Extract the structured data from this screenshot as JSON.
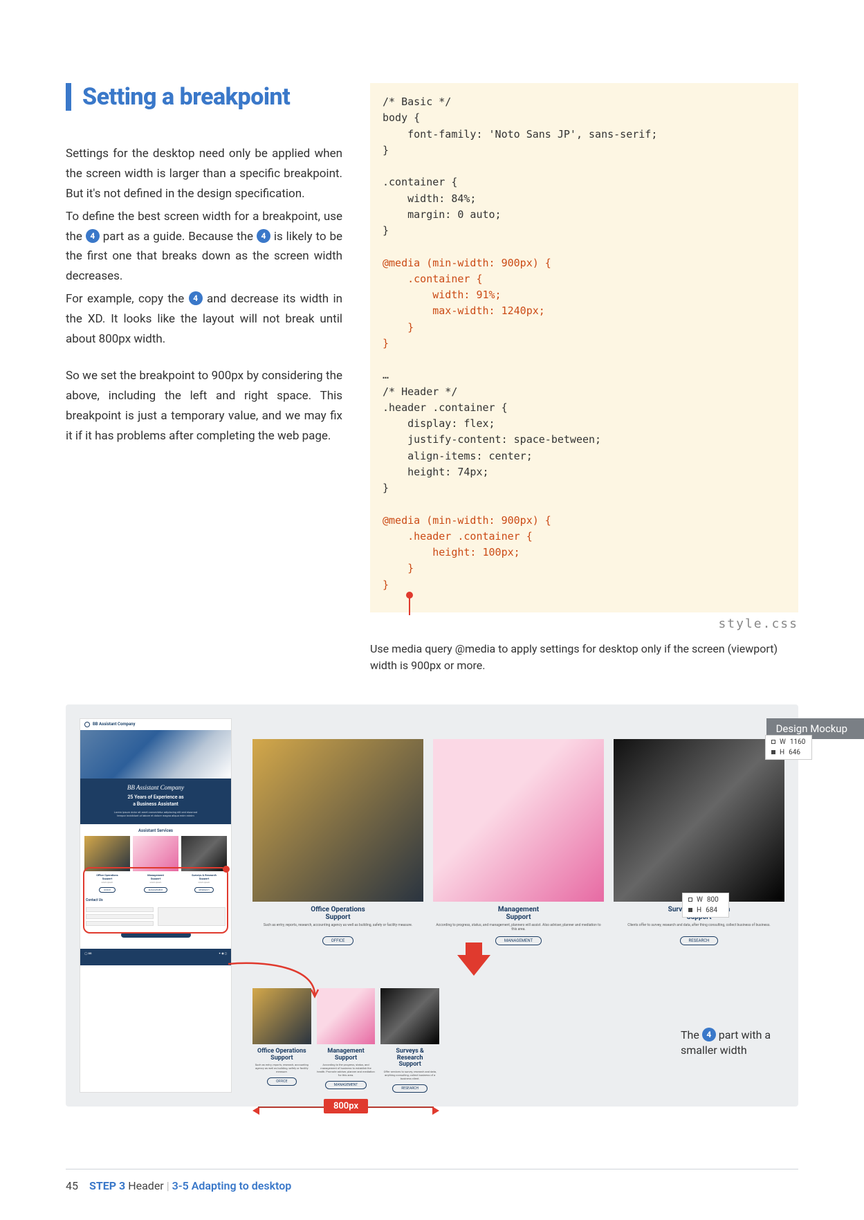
{
  "title": "Setting a breakpoint",
  "para1a": "Settings for the desktop need only be applied when the screen width is larger than a specific breakpoint. But it's not defined in the design specification.",
  "para1b_pre": "To define the best screen width for a breakpoint, use the ",
  "para1b_mid": " part as a guide. Because the ",
  "para1b_post": " is likely to be the first one that breaks down as the screen width decreases.",
  "para1c_pre": "For example, copy the ",
  "para1c_post": " and decrease its width in the XD. It looks like the layout will not break until about 800px width.",
  "para2": "So we set the breakpoint to 900px by considering the above, including the left and right space. This breakpoint is just a temporary value, and we may fix it if it has problems after completing the web page.",
  "badge_num": "4",
  "code": {
    "l1": "/* Basic */",
    "l2": "body {",
    "l3": "    font-family: 'Noto Sans JP', sans-serif;",
    "l4": "}",
    "s": "",
    "l5": ".container {",
    "l6": "    width: 84%;",
    "l7": "    margin: 0 auto;",
    "l8": "}",
    "m1a": "@media (min-width: 900px) {",
    "m1b": "    .container {",
    "m1c": "        width: 91%;",
    "m1d": "        max-width: 1240px;",
    "m1e": "    }",
    "m1f": "}",
    "dots": "…",
    "h1": "/* Header */",
    "h2": ".header .container {",
    "h3": "    display: flex;",
    "h4": "    justify-content: space-between;",
    "h5": "    align-items: center;",
    "h6": "    height: 74px;",
    "h7": "}",
    "m2a": "@media (min-width: 900px) {",
    "m2b": "    .header .container {",
    "m2c": "        height: 100px;",
    "m2d": "    }",
    "m2e": "}"
  },
  "filename": "style.css",
  "caption": "Use media query @media to apply settings for desktop only if the screen (viewport) width is 900px or more.",
  "mockup_tag": "Design Mockup",
  "mock": {
    "company": "BB Assistant Company",
    "tagline": "25 Years of Experience as\na Business Assistant",
    "services_label": "Assistant Services",
    "contact": "Contact Us",
    "cards": [
      {
        "title": "Office Operations\nSupport",
        "btn": "OFFICE"
      },
      {
        "title": "Management\nSupport",
        "btn": "MANAGEMENT"
      },
      {
        "title": "Surveys & Research\nSupport",
        "btn": "RESEARCH"
      }
    ],
    "narrow_cards": [
      {
        "title": "Office Operations\nSupport",
        "btn": "OFFICE"
      },
      {
        "title": "Management\nSupport",
        "btn": "MANAGEMENT"
      },
      {
        "title": "Surveys &\nResearch\nSupport",
        "btn": "RESEARCH"
      }
    ]
  },
  "dims_top": {
    "w": "1160",
    "h": "646"
  },
  "dims_mid": {
    "w": "800",
    "h": "684"
  },
  "width_label": "800px",
  "annot_pre": "The ",
  "annot_post": " part with a smaller width",
  "footer": {
    "page": "45",
    "step": "STEP 3",
    "step_name": "Header",
    "topic_num": "3-5",
    "topic": "Adapting to desktop"
  }
}
